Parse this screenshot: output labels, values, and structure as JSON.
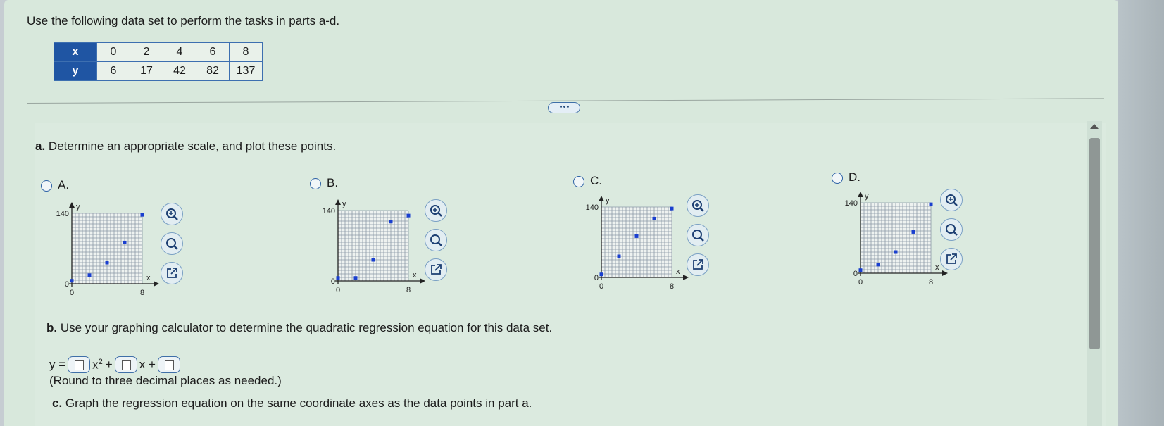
{
  "intro": "Use the following data set to perform the tasks in parts a-d.",
  "table": {
    "x_label": "x",
    "y_label": "y",
    "x_values": [
      "0",
      "2",
      "4",
      "6",
      "8"
    ],
    "y_values": [
      "6",
      "17",
      "42",
      "82",
      "137"
    ]
  },
  "more_button": "• • •",
  "part_a": {
    "letter": "a.",
    "text": "Determine an appropriate scale, and plot these points."
  },
  "options": [
    {
      "label": "A.",
      "y_tick": "140",
      "y_zero": "0",
      "x_zero": "0",
      "x_tick": "8",
      "x_axis": "x",
      "y_axis": "y"
    },
    {
      "label": "B.",
      "y_tick": "140",
      "y_zero": "0",
      "x_zero": "0",
      "x_tick": "8",
      "x_axis": "x",
      "y_axis": "y"
    },
    {
      "label": "C.",
      "y_tick": "140",
      "y_zero": "0",
      "x_zero": "0",
      "x_tick": "8",
      "x_axis": "x",
      "y_axis": "y"
    },
    {
      "label": "D.",
      "y_tick": "140",
      "y_zero": "0",
      "x_zero": "0",
      "x_tick": "8",
      "x_axis": "x",
      "y_axis": "y"
    }
  ],
  "option_points": [
    [
      [
        0,
        6
      ],
      [
        2,
        17
      ],
      [
        4,
        42
      ],
      [
        6,
        82
      ],
      [
        8,
        137
      ]
    ],
    [
      [
        0,
        6
      ],
      [
        2,
        6
      ],
      [
        4,
        42
      ],
      [
        6,
        118
      ],
      [
        8,
        130
      ]
    ],
    [
      [
        0,
        6
      ],
      [
        2,
        42
      ],
      [
        4,
        82
      ],
      [
        6,
        117
      ],
      [
        8,
        137
      ]
    ],
    [
      [
        0,
        6
      ],
      [
        2,
        17
      ],
      [
        4,
        42
      ],
      [
        6,
        82
      ],
      [
        8,
        137
      ]
    ]
  ],
  "icons": [
    "zoom-in-icon",
    "zoom-out-icon",
    "open-external-icon"
  ],
  "part_b": {
    "letter": "b.",
    "text": "Use your graphing calculator to determine the quadratic regression equation for this data set."
  },
  "equation": {
    "prefix": "y =",
    "x2": "x",
    "exp": "2",
    "plus1": "+",
    "x1": "x +"
  },
  "round_note": "(Round to three decimal places as needed.)",
  "part_c": {
    "letter": "c.",
    "text": "Graph the regression equation on the same coordinate axes as the data points in part a."
  },
  "colors": {
    "accent": "#1f55a3",
    "point": "#1a3fcf",
    "background": "#d8e8dc"
  }
}
